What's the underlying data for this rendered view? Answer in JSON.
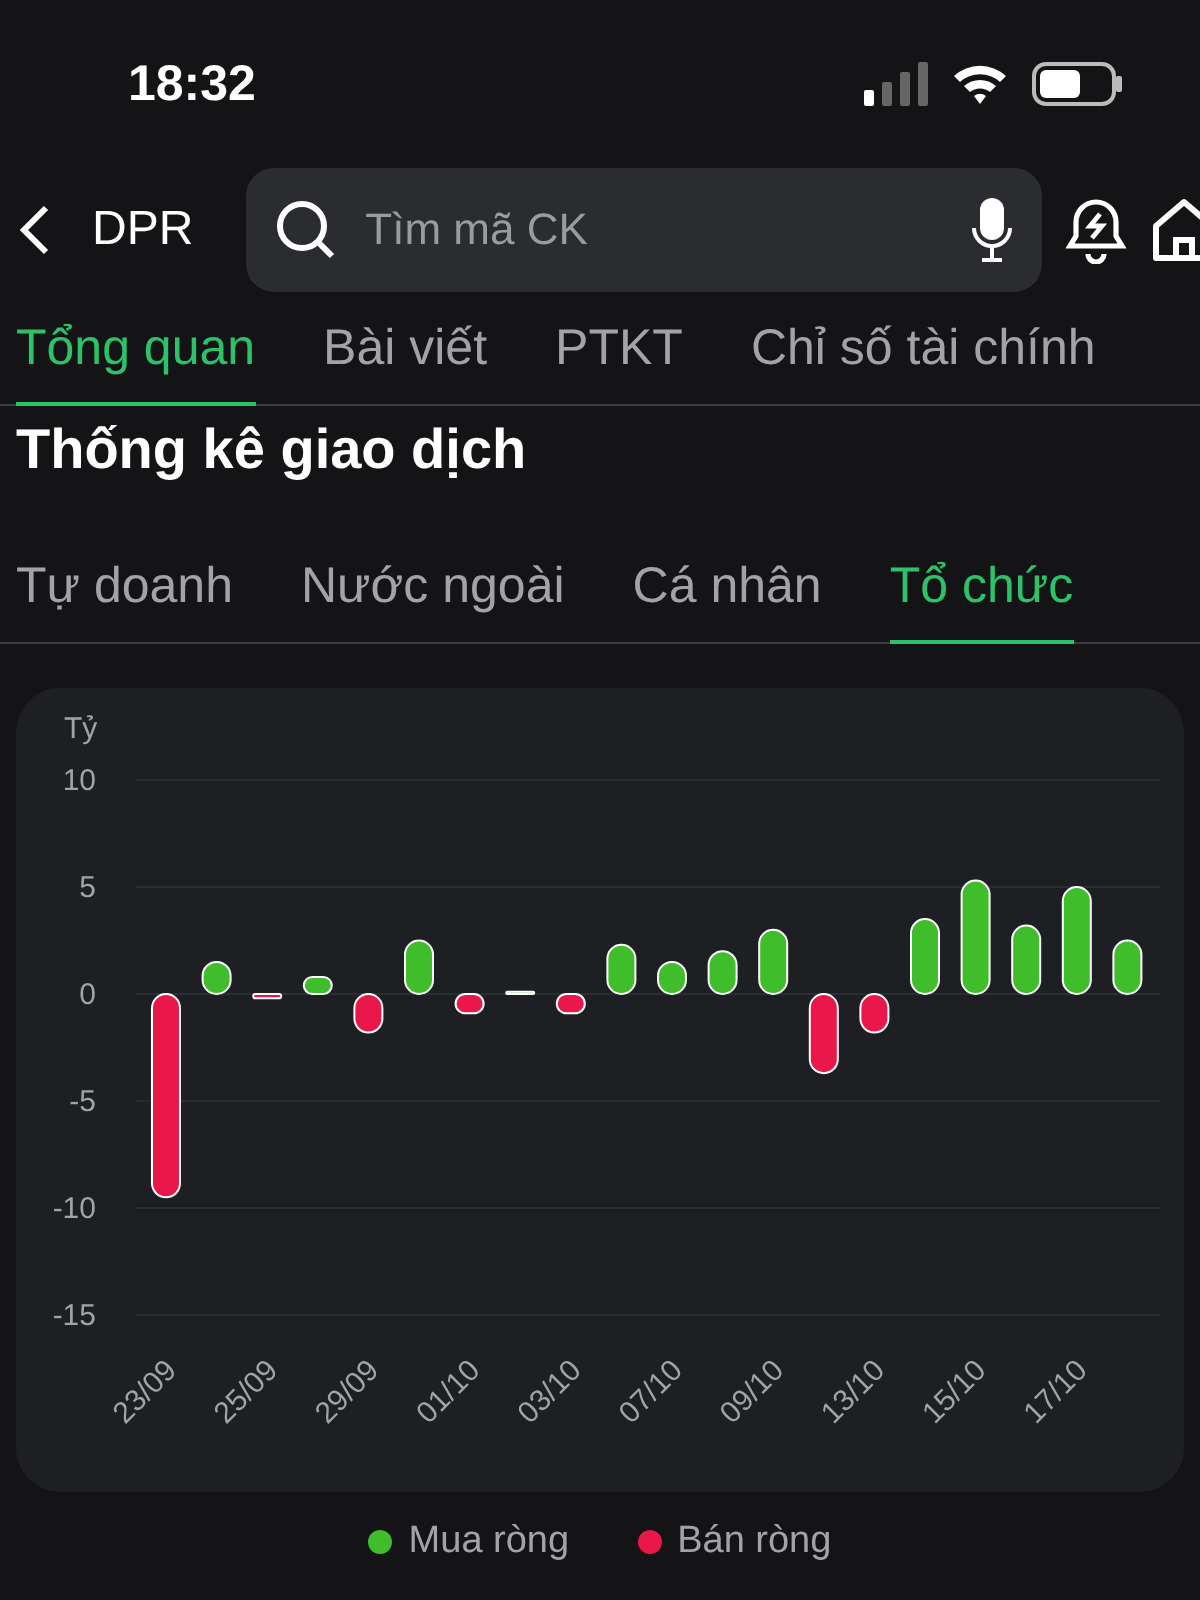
{
  "status_bar": {
    "time": "18:32"
  },
  "header": {
    "symbol": "DPR",
    "search": {
      "placeholder": "Tìm mã CK"
    }
  },
  "tabs": [
    {
      "label": "Tổng quan",
      "selected": true
    },
    {
      "label": "Bài viết",
      "selected": false
    },
    {
      "label": "PTKT",
      "selected": false
    },
    {
      "label": "Chỉ số tài chính",
      "selected": false
    }
  ],
  "section_title": "Thống kê giao dịch",
  "sub_tabs": [
    {
      "label": "Tự doanh",
      "selected": false
    },
    {
      "label": "Nước ngoài",
      "selected": false
    },
    {
      "label": "Cá nhân",
      "selected": false
    },
    {
      "label": "Tổ chức",
      "selected": true
    }
  ],
  "chart": {
    "chart_data": {
      "type": "bar",
      "ylabel": "Tỷ",
      "grid": true,
      "categories": [
        "23/09",
        null,
        "25/09",
        null,
        "29/09",
        null,
        "01/10",
        null,
        "03/10",
        null,
        "07/10",
        null,
        "09/10",
        null,
        "13/10",
        null,
        "15/10",
        null,
        "17/10",
        null
      ],
      "yticks": [
        10,
        5,
        0,
        -5,
        -10,
        -15
      ],
      "ylim": [
        -15,
        10
      ],
      "series": [
        {
          "name": "Mua ròng",
          "color": "#3fbd2b",
          "values": [
            null,
            1.5,
            null,
            0.8,
            null,
            2.5,
            null,
            0.1,
            null,
            2.3,
            1.5,
            2.0,
            3.0,
            null,
            null,
            3.5,
            5.3,
            3.2,
            5.0,
            2.5
          ]
        },
        {
          "name": "Bán ròng",
          "color": "#e9174a",
          "values": [
            -9.5,
            null,
            -0.2,
            null,
            -1.8,
            null,
            -0.9,
            null,
            -0.9,
            null,
            null,
            null,
            null,
            -3.7,
            -1.8,
            null,
            null,
            null,
            null,
            null
          ]
        }
      ]
    }
  }
}
